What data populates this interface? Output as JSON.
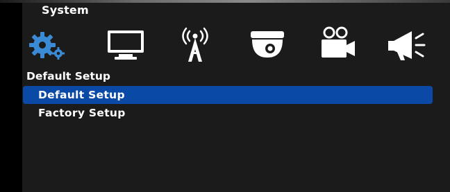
{
  "header": {
    "title": "System"
  },
  "icons": [
    {
      "name": "system-gear-icon",
      "label": "system",
      "active": true
    },
    {
      "name": "monitor-icon",
      "label": "display"
    },
    {
      "name": "antenna-tower-icon",
      "label": "network"
    },
    {
      "name": "dome-camera-icon",
      "label": "camera"
    },
    {
      "name": "video-camera-icon",
      "label": "record"
    },
    {
      "name": "megaphone-icon",
      "label": "alarm"
    }
  ],
  "section": {
    "label": "Default Setup"
  },
  "list": {
    "items": [
      {
        "label": "Default Setup",
        "selected": true
      },
      {
        "label": "Factory Setup",
        "selected": false
      }
    ]
  },
  "colors": {
    "selection": "#0a4aa6",
    "active_icon": "#3a8ad6",
    "background": "#1b1b1b"
  }
}
